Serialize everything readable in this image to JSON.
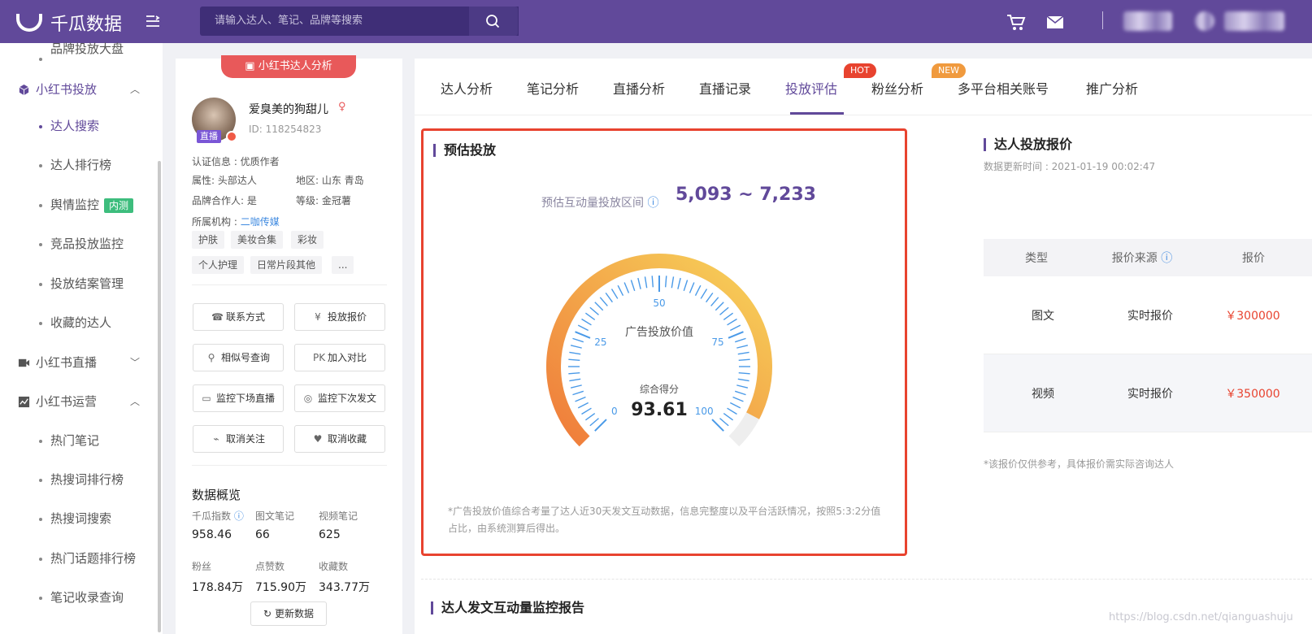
{
  "header": {
    "logo_text": "千瓜数据",
    "search_placeholder": "请输入达人、笔记、品牌等搜索",
    "icons": [
      "menu-toggle-icon",
      "search-icon",
      "cart-icon",
      "mail-icon"
    ]
  },
  "sidebar": {
    "top_cut_item": "品牌投放大盘",
    "groups": [
      {
        "label": "小红书投放",
        "items": [
          "达人搜索",
          "达人排行榜",
          "舆情监控",
          "竞品投放监控",
          "投放结案管理",
          "收藏的达人"
        ]
      },
      {
        "label": "小红书直播",
        "items": []
      },
      {
        "label": "小红书运营",
        "items": [
          "热门笔记",
          "热搜词排行榜",
          "热搜词搜索",
          "热门话题排行榜",
          "笔记收录查询"
        ]
      }
    ],
    "badge_inner_test": "内测",
    "active_item": "达人搜索"
  },
  "profile": {
    "top_tag": "小红书达人分析",
    "live_badge": "直播",
    "name": "爱臭美的狗甜儿",
    "id": "ID:  118254823",
    "cert": "认证信息 : 优质作者",
    "attr": "属性: 头部达人",
    "region": "地区: 山东 青岛",
    "brand_partner": "品牌合作人: 是",
    "level": "等级: 金冠薯",
    "org_label": "所属机构 : ",
    "org_value": "二咖传媒",
    "tags": [
      "护肤",
      "美妆合集",
      "彩妆",
      "个人护理",
      "日常片段其他",
      "..."
    ],
    "buttons": [
      "联系方式",
      "投放报价",
      "相似号查询",
      "加入对比",
      "监控下场直播",
      "监控下次发文",
      "取消关注",
      "取消收藏"
    ],
    "overview_title": "数据概览",
    "stats": [
      {
        "label": "千瓜指数",
        "value": "958.46"
      },
      {
        "label": "图文笔记",
        "value": "66"
      },
      {
        "label": "视频笔记",
        "value": "625"
      },
      {
        "label": "粉丝",
        "value": "178.84万"
      },
      {
        "label": "点赞数",
        "value": "715.90万"
      },
      {
        "label": "收藏数",
        "value": "343.77万"
      }
    ],
    "refresh_label": "更新数据"
  },
  "tabs": {
    "items": [
      "达人分析",
      "笔记分析",
      "直播分析",
      "直播记录",
      "投放评估",
      "粉丝分析",
      "多平台相关账号",
      "推广分析"
    ],
    "active": "投放评估",
    "hot_badge": "HOT",
    "new_badge": "NEW"
  },
  "estimate": {
    "title": "预估投放",
    "range_label": "预估互动量投放区间",
    "range_value": "5,093 ~ 7,233",
    "gauge_center_label": "广告投放价值",
    "score_label": "综合得分",
    "score_value": "93.61",
    "score_fraction": 0.9361,
    "ticks": [
      "0",
      "25",
      "50",
      "75",
      "100"
    ],
    "footnote": "*广告投放价值综合考量了达人近30天发文互动数据，信息完整度以及平台活跃情况，按照5:3:2分值占比，由系统测算后得出。"
  },
  "quote": {
    "title": "达人投放报价",
    "updated": "数据更新时间 : 2021-01-19 00:02:47",
    "headers": [
      "类型",
      "报价来源",
      "报价"
    ],
    "rows": [
      {
        "type": "图文",
        "source": "实时报价",
        "price": "￥300000"
      },
      {
        "type": "视频",
        "source": "实时报价",
        "price": "￥350000"
      }
    ],
    "note": "*该报价仅供参考，具体报价需实际咨询达人"
  },
  "monitor_title": "达人发文互动量监控报告",
  "watermark": "https://blog.csdn.net/qianguashuju"
}
